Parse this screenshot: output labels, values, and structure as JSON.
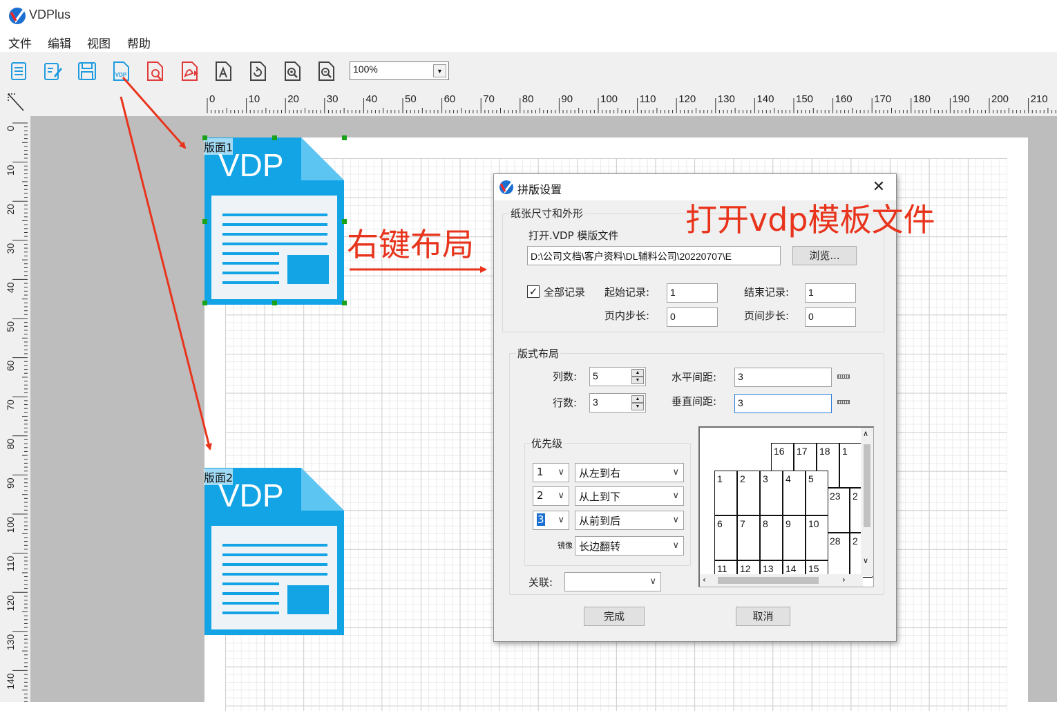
{
  "app": {
    "title": "VDPlus"
  },
  "menu": [
    "文件",
    "编辑",
    "视图",
    "帮助"
  ],
  "toolbar": {
    "buttons": [
      "new-icon",
      "edit-icon",
      "save-icon",
      "vdp-file-icon",
      "pdf-preview-icon",
      "pdf-export-icon",
      "text-icon",
      "rotate-icon",
      "zoom-in-icon",
      "zoom-out-icon"
    ],
    "vdp_badge": "VDP",
    "zoom": "100%"
  },
  "ruler": {
    "h": [
      "0",
      "10",
      "20",
      "30",
      "40",
      "50",
      "60",
      "70",
      "80",
      "90",
      "100",
      "110",
      "120",
      "130",
      "140",
      "150",
      "160",
      "170",
      "180",
      "190",
      "200",
      "210"
    ],
    "v": [
      "0",
      "10",
      "20",
      "30",
      "40",
      "50",
      "60",
      "70",
      "80",
      "90",
      "100",
      "110",
      "120",
      "130",
      "140"
    ]
  },
  "plates": [
    {
      "label": "版面1",
      "art_text": "VDP"
    },
    {
      "label": "版面2",
      "art_text": "VDP"
    }
  ],
  "dialog": {
    "title": "拼版设置",
    "paper_group": "纸张尺寸和外形",
    "open_label": "打开.VDP 模版文件",
    "file_path": "D:\\公司文档\\客户资料\\DL辅料公司\\20220707\\E",
    "browse": "浏览...",
    "all_records": "全部记录",
    "all_records_checked": true,
    "start_record_label": "起始记录:",
    "start_record": "1",
    "end_record_label": "结束记录:",
    "end_record": "1",
    "inpage_step_label": "页内步长:",
    "inpage_step": "0",
    "interpage_step_label": "页间步长:",
    "interpage_step": "0",
    "layout_group": "版式布局",
    "cols_label": "列数:",
    "cols": "5",
    "rows_label": "行数:",
    "rows": "3",
    "hgap_label": "水平间距:",
    "hgap": "3",
    "vgap_label": "垂直间距:",
    "vgap": "3",
    "priority_group": "优先级",
    "priorities": [
      {
        "num": "1",
        "dir": "从左到右"
      },
      {
        "num": "2",
        "dir": "从上到下"
      },
      {
        "num": "3",
        "dir": "从前到后"
      }
    ],
    "mirror_label": "镜像",
    "mirror": "长边翻转",
    "link_label": "关联:",
    "link": "",
    "preview_back": [
      "16",
      "17",
      "18",
      "1"
    ],
    "preview_back_row2": [
      "23",
      "2"
    ],
    "preview_back_row3": [
      "28",
      "2"
    ],
    "preview_front_row1": [
      "1",
      "2",
      "3",
      "4",
      "5"
    ],
    "preview_front_row2": [
      "6",
      "7",
      "8",
      "9",
      "10"
    ],
    "preview_front_row3": [
      "11",
      "12",
      "13",
      "14",
      "15"
    ],
    "ok": "完成",
    "cancel": "取消"
  },
  "annotations": {
    "right_click": "右键布局",
    "open_vdp": "打开vdp模板文件",
    "color": "#e8341c"
  }
}
